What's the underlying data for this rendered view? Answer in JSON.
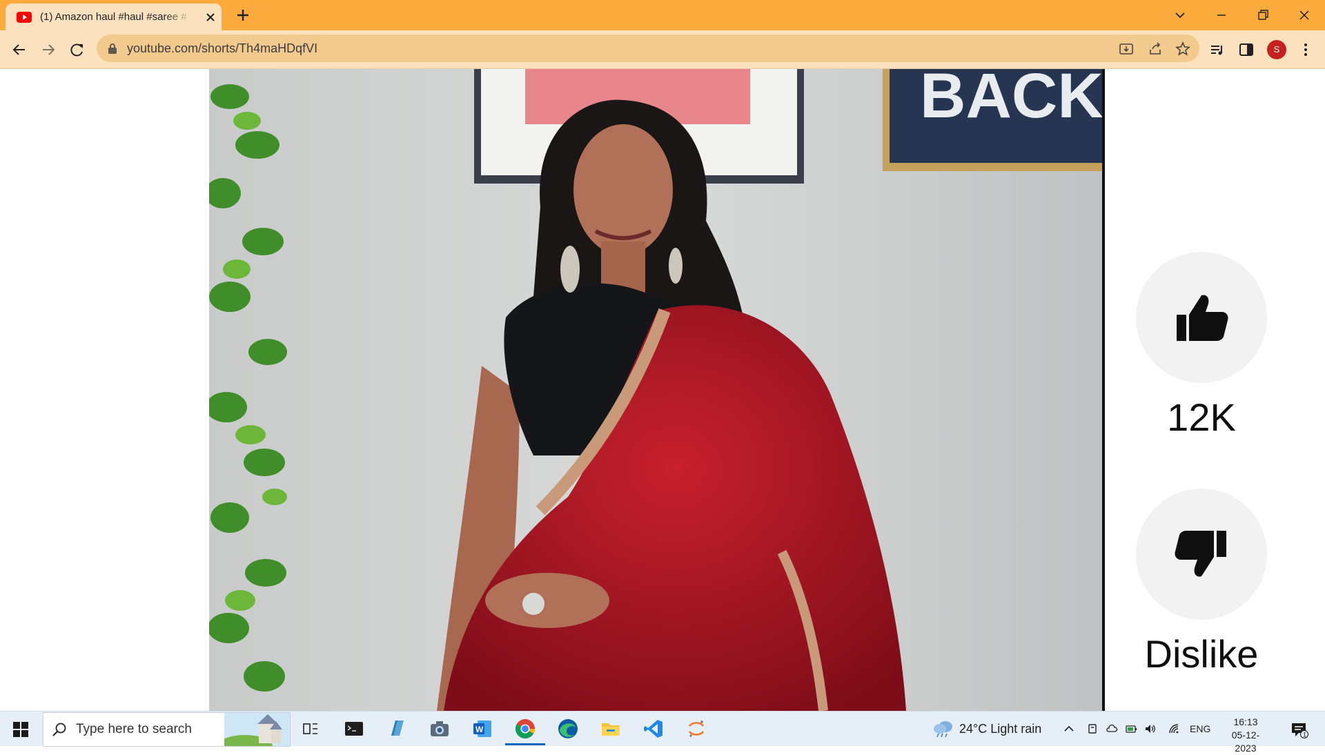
{
  "browser": {
    "tab_title": "(1) Amazon haul #haul #saree #",
    "url": "youtube.com/shorts/Th4maHDqfVI",
    "profile_initial": "S"
  },
  "shorts": {
    "like_count": "12K",
    "dislike_label": "Dislike"
  },
  "taskbar": {
    "search_placeholder": "Type here to search",
    "weather": "24°C  Light rain",
    "language": "ENG",
    "time": "16:13",
    "date": "05-12-2023",
    "notification_count": "1"
  },
  "colors": {
    "tabbar": "#fdab3d",
    "toolbar": "#fbe1bd",
    "omnibox": "#f3ca8e",
    "youtube_red": "#ff0000",
    "action_circle": "#f2f2f2"
  }
}
